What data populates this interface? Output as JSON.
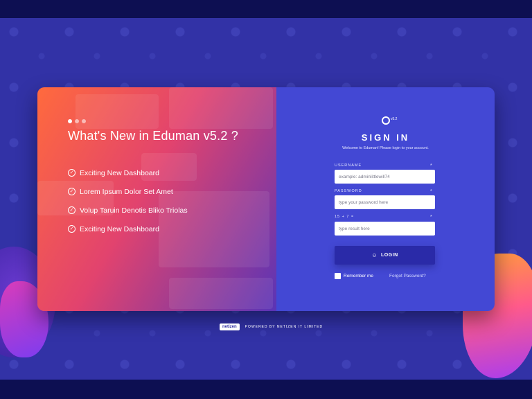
{
  "promo": {
    "headline": "What's New in Eduman v5.2 ?",
    "features": [
      {
        "label": "Exciting New Dashboard"
      },
      {
        "label": "Lorem Ipsum Dolor Set Amet"
      },
      {
        "label": "Volup Taruin Denotis Bliko Triolas"
      },
      {
        "label": "Exciting New Dashboard"
      }
    ]
  },
  "signin": {
    "logo_version": "v5.2",
    "title": "SIGN IN",
    "subtitle": "Welcome to Eduman! Please login to your account.",
    "username_label": "USERNAME",
    "username_placeholder": "example: adminlittlewill74",
    "password_label": "PASSWORD",
    "password_placeholder": "type your password here",
    "captcha_label": "15 + 7 =",
    "captcha_placeholder": "type result here",
    "required_mark": "*",
    "login_label": "LOGIN",
    "remember_label": "Remember me",
    "forgot_label": "Forgot Password?"
  },
  "footer": {
    "logo_text": "netizen",
    "powered_by": "POWERED BY NETIZEN IT LIMITED"
  },
  "colors": {
    "background": "#3232a6",
    "form_panel": "#4348d4",
    "login_button": "#2a2aa8",
    "gradient_start": "#ff6a3d",
    "gradient_end": "#5a34b6"
  },
  "icons": {
    "feature_check": "check-circle-icon",
    "login": "user-icon",
    "logo": "eduman-logo-icon"
  }
}
